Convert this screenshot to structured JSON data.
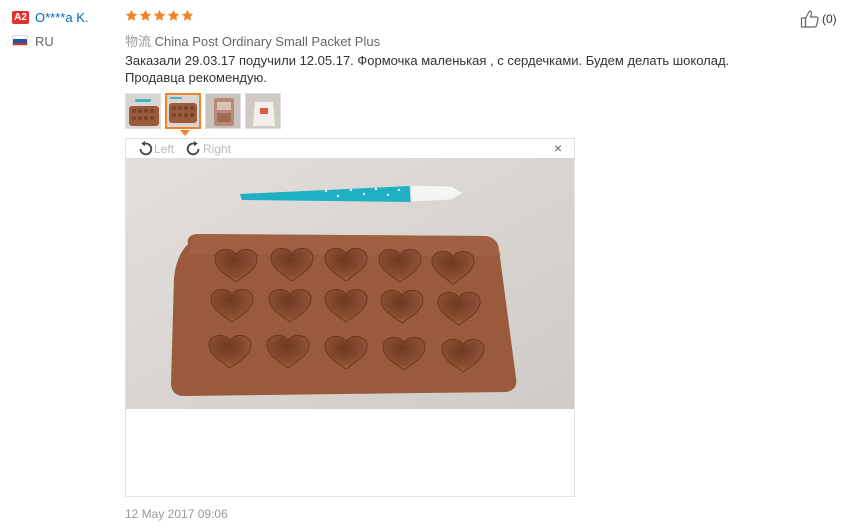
{
  "reviewer": {
    "level_badge": "A2",
    "name": "O****a K.",
    "country": "RU"
  },
  "rating": {
    "stars": 5,
    "max": 5,
    "color": "#f0842a"
  },
  "shipping": {
    "label": "物流",
    "method": "China Post Ordinary Small Packet Plus"
  },
  "review_text": "Заказали 29.03.17 подучили 12.05.17. Формочка маленькая , с сердечками. Будем делать шоколад. Продавца рекомендую.",
  "thumbnails": [
    {
      "icon": "photo-thumbnail-mold-with-pen",
      "active": false
    },
    {
      "icon": "photo-thumbnail-mold-closeup",
      "active": true
    },
    {
      "icon": "photo-thumbnail-package",
      "active": false
    },
    {
      "icon": "photo-thumbnail-bag",
      "active": false
    }
  ],
  "viewer": {
    "rotate_left_label": "Left",
    "rotate_right_label": "Right",
    "close_symbol": "×"
  },
  "helpful": {
    "count": "(0)"
  },
  "date": "12 May 2017 09:06",
  "colors": {
    "link": "#0066c0",
    "accent": "#f0842a",
    "badge": "#e6302e",
    "mold": "#9a5a3c"
  }
}
